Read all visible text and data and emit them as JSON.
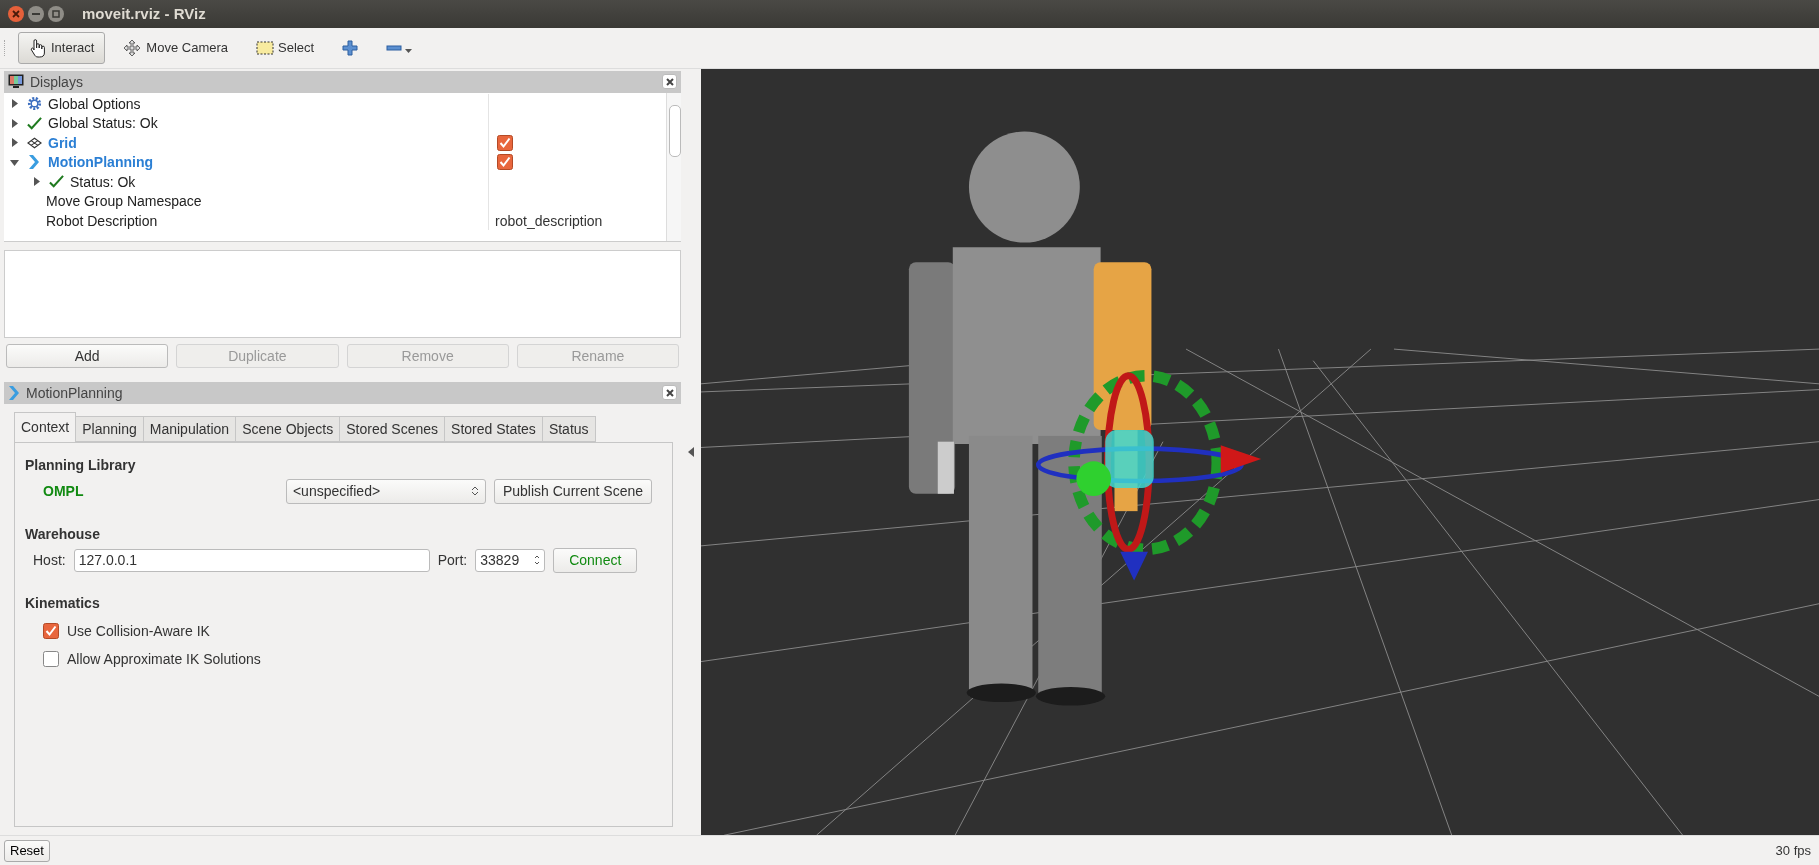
{
  "window": {
    "title": "moveit.rviz - RViz"
  },
  "toolbar": [
    {
      "kind": "interact",
      "label": "Interact",
      "selected": true
    },
    {
      "kind": "move-camera",
      "label": "Move Camera",
      "selected": false
    },
    {
      "kind": "select",
      "label": "Select",
      "selected": false
    },
    {
      "kind": "add",
      "selected": false
    },
    {
      "kind": "remove",
      "selected": false
    }
  ],
  "displays": {
    "title": "Displays",
    "tree": [
      {
        "kind": "gear",
        "label": "Global Options",
        "expanded": false,
        "highlighted": false
      },
      {
        "kind": "check",
        "label": "Global Status: Ok",
        "expanded": false,
        "highlighted": false
      },
      {
        "kind": "grid",
        "label": "Grid",
        "expanded": false,
        "highlighted": true,
        "checked": true
      },
      {
        "kind": "plugin",
        "label": "MotionPlanning",
        "expanded": true,
        "highlighted": true,
        "checked": true,
        "children": [
          {
            "kind": "check",
            "label": "Status: Ok",
            "expanded": false,
            "highlighted": false
          },
          {
            "label": "Move Group Namespace",
            "highlighted": false
          },
          {
            "label": "Robot Description",
            "highlighted": false,
            "value": "robot_description"
          }
        ]
      }
    ],
    "buttons": [
      {
        "label": "Add",
        "disabled": false
      },
      {
        "label": "Duplicate",
        "disabled": true
      },
      {
        "label": "Remove",
        "disabled": true
      },
      {
        "label": "Rename",
        "disabled": true
      }
    ]
  },
  "motion_planning": {
    "title": "MotionPlanning",
    "tabs": [
      {
        "label": "Context",
        "selected": true
      },
      {
        "label": "Planning",
        "selected": false
      },
      {
        "label": "Manipulation",
        "selected": false
      },
      {
        "label": "Scene Objects",
        "selected": false
      },
      {
        "label": "Stored Scenes",
        "selected": false
      },
      {
        "label": "Stored States",
        "selected": false
      },
      {
        "label": "Status",
        "selected": false
      }
    ],
    "planning_library": {
      "heading": "Planning Library",
      "library": "OMPL",
      "planner": "<unspecified>",
      "publish_button": "Publish Current Scene"
    },
    "warehouse": {
      "heading": "Warehouse",
      "host_label": "Host:",
      "host": "127.0.0.1",
      "port_label": "Port:",
      "port": "33829",
      "connect_button": "Connect"
    },
    "kinematics": {
      "heading": "Kinematics",
      "options": [
        {
          "label": "Use Collision-Aware IK",
          "checked": true
        },
        {
          "label": "Allow Approximate IK Solutions",
          "checked": false
        }
      ]
    }
  },
  "status_bar": {
    "reset_button": "Reset",
    "fps": "30 fps"
  }
}
